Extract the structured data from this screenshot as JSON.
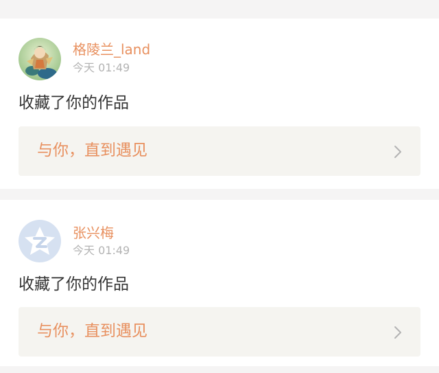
{
  "notifications": [
    {
      "username": "格陵兰_land",
      "time": "今天 01:49",
      "action": "收藏了你的作品",
      "work_title": "与你，直到遇见",
      "avatar_icon": "illustrated-character-avatar"
    },
    {
      "username": "张兴梅",
      "time": "今天 01:49",
      "action": "收藏了你的作品",
      "work_title": "与你，直到遇见",
      "avatar_icon": "qzone-default-avatar"
    }
  ],
  "colors": {
    "accent": "#e8905f",
    "muted": "#b3b3b3",
    "text": "#333333",
    "background": "#f5f4f4",
    "card": "#ffffff",
    "work_box": "#f5f4f0"
  }
}
